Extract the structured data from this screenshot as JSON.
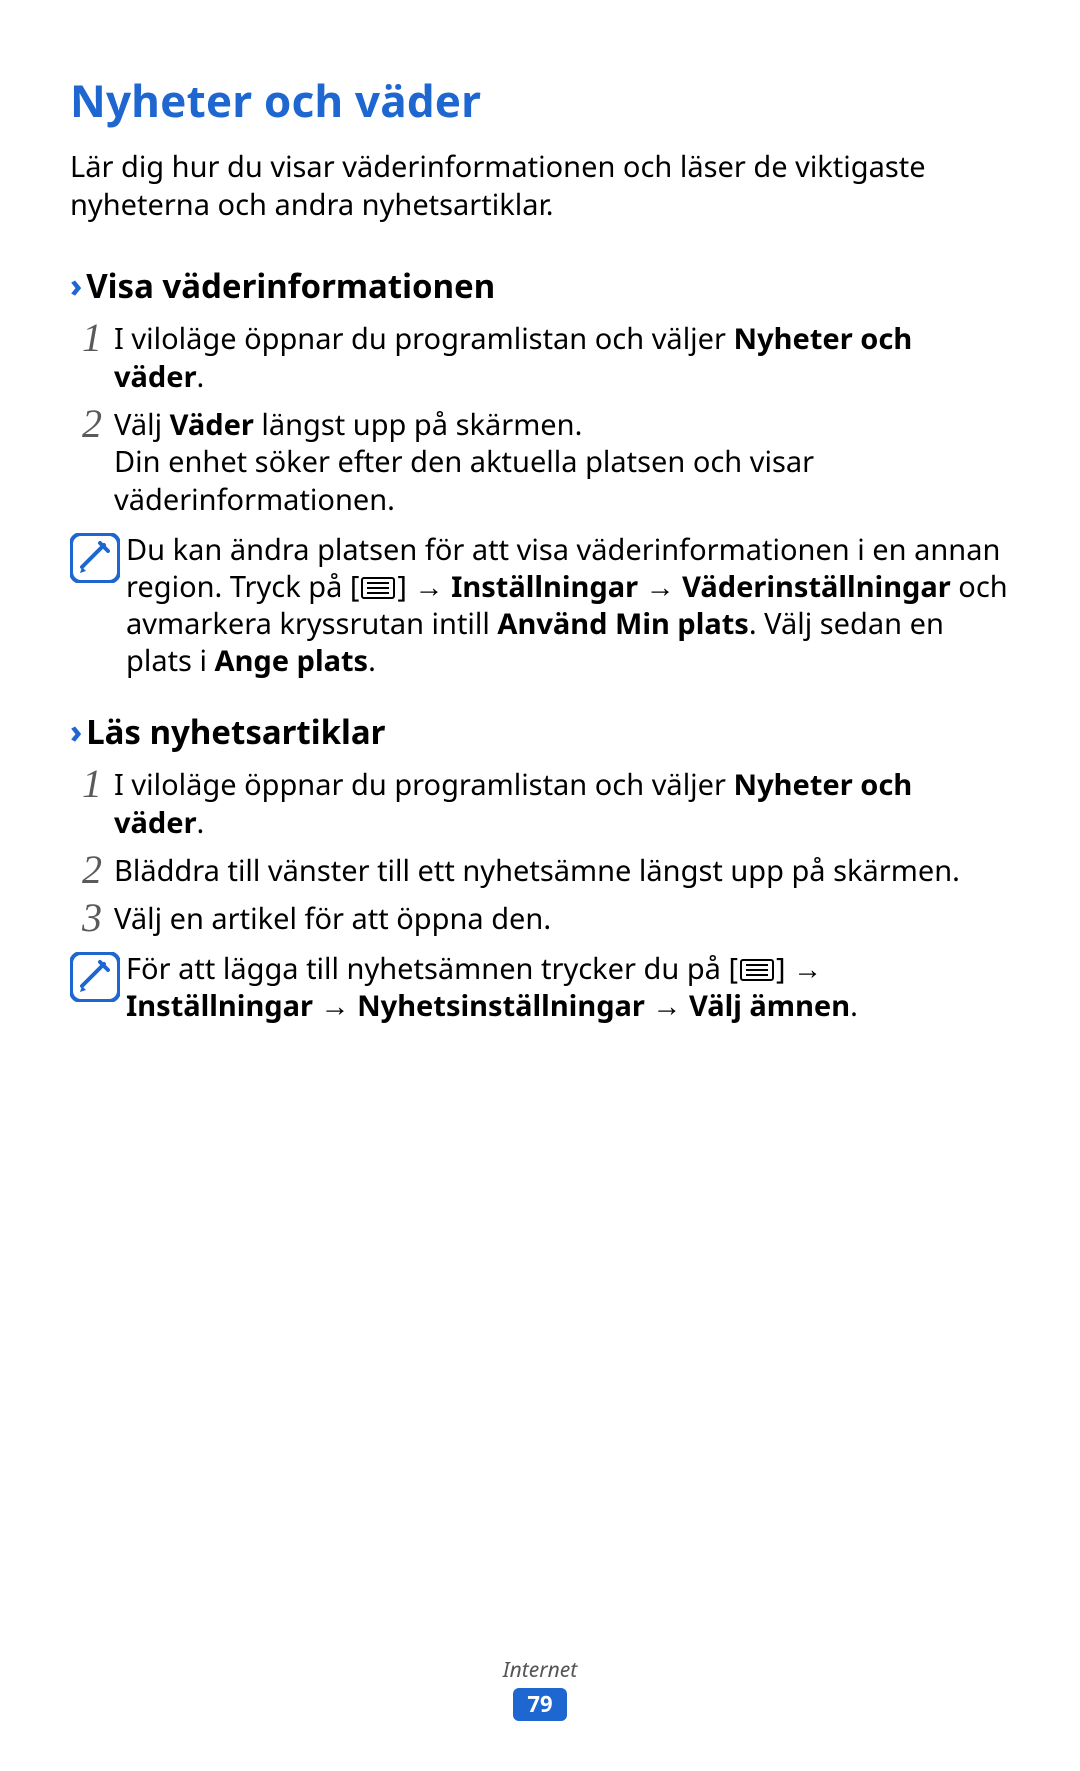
{
  "title": "Nyheter och väder",
  "intro": "Lär dig hur du visar väderinformationen och läser de viktigaste nyheterna och andra nyhetsartiklar.",
  "section_a": {
    "heading": "Visa väderinformationen",
    "steps": {
      "one": {
        "num": "1",
        "pre": "I viloläge öppnar du programlistan och väljer ",
        "bold": "Nyheter och väder",
        "post": "."
      },
      "two": {
        "num": "2",
        "pre": "Välj ",
        "bold": "Väder",
        "mid": " längst upp på skärmen.",
        "extra": "Din enhet söker efter den aktuella platsen och visar väderinformationen."
      }
    },
    "note": {
      "line1": "Du kan ändra platsen för att visa väderinformationen i en annan region. Tryck på [",
      "after_glyph": "] ",
      "arrow1": "→ ",
      "settings": "Inställningar",
      "arrow2": " → ",
      "weather_settings": "Väderinställningar",
      "mid": " och avmarkera kryssrutan intill ",
      "use_loc": "Använd Min plats",
      "mid2": ". Välj sedan en plats i ",
      "enter_loc": "Ange plats",
      "end": "."
    }
  },
  "section_b": {
    "heading": "Läs nyhetsartiklar",
    "steps": {
      "one": {
        "num": "1",
        "pre": "I viloläge öppnar du programlistan och väljer ",
        "bold": "Nyheter och väder",
        "post": "."
      },
      "two": {
        "num": "2",
        "text": "Bläddra till vänster till ett nyhetsämne längst upp på skärmen."
      },
      "three": {
        "num": "3",
        "text": "Välj en artikel för att öppna den."
      }
    },
    "note": {
      "line1": "För att lägga till nyhetsämnen trycker du på [",
      "after_glyph": "] ",
      "arrow1": "→ ",
      "settings": "Inställningar",
      "arrow2": " → ",
      "news_settings": "Nyhetsinställningar",
      "arrow3": " → ",
      "topics": "Välj ämnen",
      "end": "."
    }
  },
  "footer": {
    "section": "Internet",
    "page": "79"
  }
}
